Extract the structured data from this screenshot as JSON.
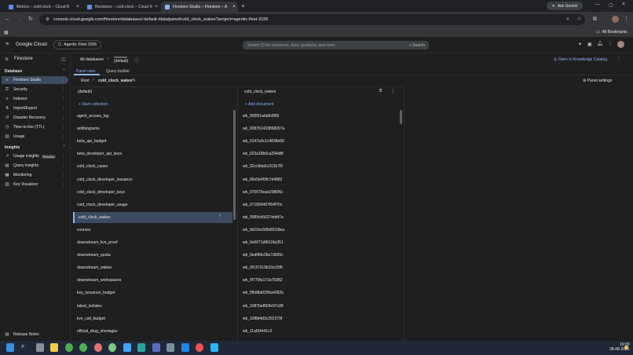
{
  "browser": {
    "tabs": [
      {
        "label": "Metrics – cold-clock – Cloud R"
      },
      {
        "label": "Revisions – cold-clock – Cloud R"
      },
      {
        "label": "Firestore Studio – Firestore – A"
      }
    ],
    "new_tab": "+",
    "ask_gemini": "Ask Gemini",
    "url": "console.cloud.google.com/firestore/databases/-default-/data/panel/cold_clock_wakes?project=agentic-fleet-2026",
    "all_bookmarks": "All Bookmarks"
  },
  "console": {
    "brand": "Google Cloud",
    "project": "Agentic Fleet 2026",
    "search_placeholder": "Search (/) for resources, docs, products, and more",
    "search_button": "Search"
  },
  "sidebar": {
    "product": "Firestore",
    "database_section": "Database",
    "database_items": [
      {
        "label": "Firestore Studio",
        "icon": "studio-icon"
      },
      {
        "label": "Security",
        "icon": "lock-icon"
      },
      {
        "label": "Indexes",
        "icon": "index-icon"
      },
      {
        "label": "Import/Export",
        "icon": "import-icon"
      },
      {
        "label": "Disaster Recovery",
        "icon": "recovery-icon"
      },
      {
        "label": "Time-to-live (TTL)",
        "icon": "clock-icon"
      },
      {
        "label": "Usage",
        "icon": "usage-icon"
      }
    ],
    "insights_section": "Insights",
    "insights_items": [
      {
        "label": "Usage insights",
        "badge": "Preview",
        "icon": "chart-icon"
      },
      {
        "label": "Query insights",
        "icon": "chart-icon"
      },
      {
        "label": "Monitoring",
        "icon": "monitor-icon"
      },
      {
        "label": "Key Visualizer",
        "icon": "key-icon"
      }
    ],
    "release_notes": "Release Notes"
  },
  "header": {
    "all_databases": "All databases",
    "database_label": "Database",
    "database_value": "(default)",
    "open_catalog": "Open in Knowledge Catalog"
  },
  "tabs": {
    "panel_view": "Panel view",
    "query_builder": "Query builder"
  },
  "breadcrumb": {
    "root": "Root",
    "collection": "cold_clock_wakes",
    "panel_settings": "Panel settings"
  },
  "panel_left": {
    "title": "(default)",
    "start_collection": "Start collection",
    "collections": [
      "agent_access_log",
      "antibiograms",
      "beta_api_budget",
      "beta_developer_api_keys",
      "cold_clock_cases",
      "cold_clock_developer_issuance",
      "cold_clock_developer_keys",
      "cold_clock_developer_usage",
      "cold_clock_wakes",
      "courses",
      "downstream_live_proof",
      "downstream_quota",
      "downstream_wakes",
      "downstream_workspaces",
      "key_issuance_budget",
      "latest_isolates",
      "live_call_budget",
      "official_drug_shortages"
    ],
    "selected_index": 8
  },
  "panel_mid": {
    "title": "cold_clock_wakes",
    "add_document": "Add document",
    "documents": [
      "wk_006f51afa8b9f56",
      "wk_008761433868097a",
      "wk_0147a3c1c4838e58",
      "wk_023a18b6ca294d8f",
      "wk_02cc8da5c312b7f0",
      "wk_06e5b4f0fc7d4882",
      "wk_070675eae2086f6c",
      "wk_071899407f64f70c",
      "wk_0989cb5627ebfd7a",
      "wk_0d10ec586d5018ea",
      "wk_0e0071df9118a351",
      "wk_0ed0f0e36e7d926c",
      "wk_0f137319b10a15f8",
      "wk_0f779fa171b79382",
      "wk_0fb98a0290a4282b",
      "wk_1087be892fe97c08",
      "wk_10f8d4d3c292379f",
      "wk_11af34441c2"
    ]
  },
  "taskbar": {
    "time": "19:09",
    "date": "28-08-2026"
  }
}
